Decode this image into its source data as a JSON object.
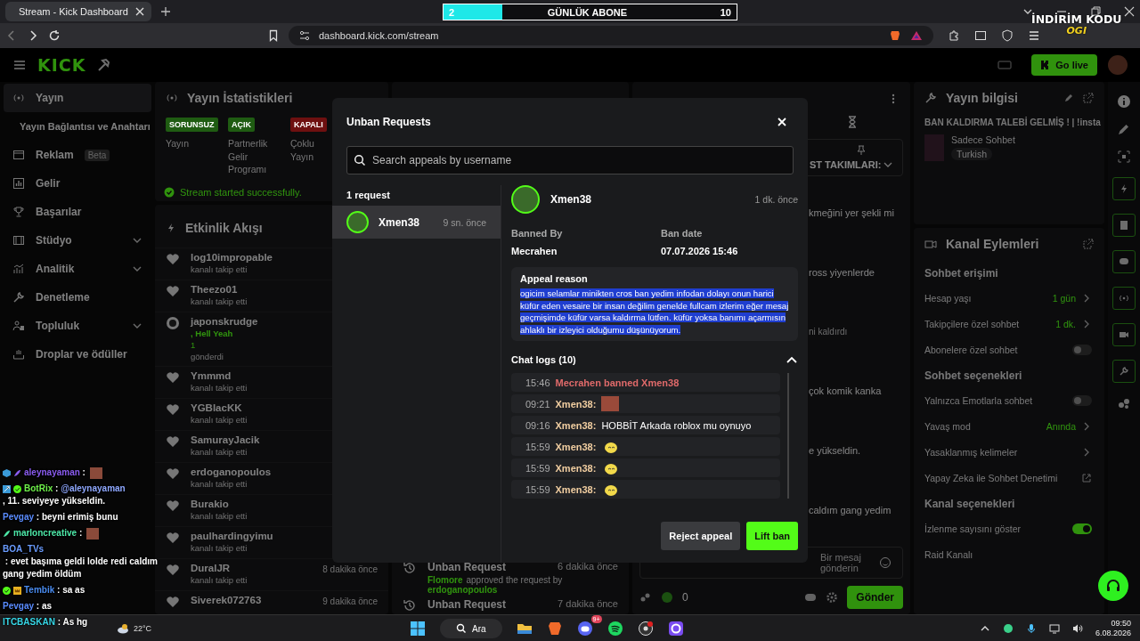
{
  "browser": {
    "tab_title": "Stream - Kick Dashboard",
    "url": "dashboard.kick.com/stream"
  },
  "sub_goal": {
    "current": "2",
    "label": "GÜNLÜK ABONE",
    "target": "10",
    "level": 0.2
  },
  "promo_overlay": {
    "title": "İNDİRİM KODU",
    "code": "OGI"
  },
  "header": {
    "logo": "KICK",
    "go_live": "Go live"
  },
  "sidebar": [
    {
      "label": "Yayın",
      "kind": "main",
      "selected": true,
      "expandable": false
    },
    {
      "label": "Yayın Bağlantısı ve Anahtarı",
      "kind": "sub",
      "selected": false,
      "expandable": false
    },
    {
      "label": "Reklam",
      "kind": "main",
      "badge": "Beta",
      "selected": false,
      "expandable": false
    },
    {
      "label": "Gelir",
      "kind": "main",
      "selected": false,
      "expandable": false
    },
    {
      "label": "Başarılar",
      "kind": "main",
      "selected": false,
      "expandable": false
    },
    {
      "label": "Stüdyo",
      "kind": "main",
      "selected": false,
      "expandable": true
    },
    {
      "label": "Analitik",
      "kind": "main",
      "selected": false,
      "expandable": true
    },
    {
      "label": "Denetleme",
      "kind": "main",
      "selected": false,
      "expandable": false
    },
    {
      "label": "Topluluk",
      "kind": "main",
      "selected": false,
      "expandable": true
    },
    {
      "label": "Droplar ve ödüller",
      "kind": "main",
      "selected": false,
      "expandable": false
    }
  ],
  "stats": {
    "title": "Yayın İstatistikleri",
    "items": [
      {
        "badge": "SORUNSUZ",
        "label": "Yayın",
        "color": "#1f5c12"
      },
      {
        "badge": "AÇIK",
        "label": "Partnerlik Gelir Programı",
        "color": "#1f5c12"
      },
      {
        "badge": "KAPALI",
        "label": "Çoklu Yayın",
        "color": "#6e1010"
      }
    ],
    "notice": "Stream started successfully."
  },
  "activity": {
    "title": "Etkinlik Akışı",
    "items": [
      {
        "kind": "follow",
        "name": "log10impropable",
        "action": "kanalı takip etti"
      },
      {
        "kind": "follow",
        "name": "Theezo01",
        "action": "kanalı takip etti"
      },
      {
        "kind": "gift",
        "name": "japonskrudge",
        "gift": ", Hell Yeah",
        "amount": "1",
        "action": "gönderdi"
      },
      {
        "kind": "follow",
        "name": "Ymmmd",
        "action": "kanalı takip etti"
      },
      {
        "kind": "follow",
        "name": "YGBlacKK",
        "action": "kanalı takip etti"
      },
      {
        "kind": "follow",
        "name": "SamurayJacik",
        "action": "kanalı takip etti"
      },
      {
        "kind": "follow",
        "name": "erdoganopoulos",
        "action": "kanalı takip etti"
      },
      {
        "kind": "follow",
        "name": "Burakio",
        "action": "kanalı takip etti"
      },
      {
        "kind": "follow",
        "name": "paulhardingyimu",
        "action": "kanalı takip etti"
      },
      {
        "kind": "follow",
        "name": "DuralJR",
        "action": "kanalı takip etti",
        "time": "8 dakika önce"
      },
      {
        "kind": "follow",
        "name": "Siverek072763",
        "time": "9 dakika önce"
      }
    ]
  },
  "mod_log": [
    {
      "title": "Unban Request",
      "time": "6 dakika önce",
      "actor": "Flomore",
      "verb": "approved the request by",
      "target": "erdoganopoulos"
    },
    {
      "title": "Unban Request",
      "time": "7 dakika önce"
    }
  ],
  "chat": {
    "pinned": "ST TAKIMLARI:",
    "lines": [
      {
        "kind": "message",
        "text": "kmeğini yer şekli mi"
      },
      {
        "kind": "message",
        "text": "ross yiyenlerde"
      },
      {
        "kind": "system",
        "text": "ni kaldırdı"
      },
      {
        "kind": "message",
        "text": "çok komik kanka"
      },
      {
        "kind": "message",
        "text": "e yükseldin."
      },
      {
        "kind": "message",
        "text": "caldım gang yedim"
      }
    ],
    "input_placeholder": "Bir mesaj gönderin",
    "kicks": "0",
    "send": "Gönder"
  },
  "stream_info": {
    "title": "Yayın bilgisi",
    "stream_title": "BAN KALDIRMA TALEBİ GELMİŞ ! | !insta",
    "category": "Sadece Sohbet",
    "tag": "Turkish"
  },
  "channel_actions": {
    "title": "Kanal Eylemleri",
    "sections": [
      {
        "heading": "Sohbet erişimi",
        "rows": [
          {
            "kind": "link",
            "label": "Hesap yaşı",
            "value": "1 gün"
          },
          {
            "kind": "link",
            "label": "Takipçilere özel sohbet",
            "value": "1 dk."
          },
          {
            "kind": "toggle",
            "label": "Abonelere özel sohbet",
            "on": false
          }
        ]
      },
      {
        "heading": "Sohbet seçenekleri",
        "rows": [
          {
            "kind": "toggle",
            "label": "Yalnızca Emotlarla sohbet",
            "on": false
          },
          {
            "kind": "link",
            "label": "Yavaş mod",
            "value": "Anında"
          },
          {
            "kind": "link",
            "label": "Yasaklanmış kelimeler"
          },
          {
            "kind": "external",
            "label": "Yapay Zeka ile Sohbet Denetimi"
          }
        ]
      },
      {
        "heading": "Kanal seçenekleri",
        "rows": [
          {
            "kind": "toggle",
            "label": "İzlenme sayısını göster",
            "on": true
          },
          {
            "kind": "plain",
            "label": "Raid Kanalı"
          }
        ]
      }
    ]
  },
  "modal": {
    "title": "Unban Requests",
    "search_placeholder": "Search appeals by username",
    "count": "1 request",
    "requests": [
      {
        "name": "Xmen38",
        "time": "9 sn. önce",
        "selected": true
      }
    ],
    "detail": {
      "name": "Xmen38",
      "time": "1 dk. önce",
      "banned_by_label": "Banned By",
      "banned_by": "Mecrahen",
      "ban_date_label": "Ban date",
      "ban_date": "07.07.2026 15:46",
      "reason_label": "Appeal reason",
      "reason": "ogicim selamlar minikten cros ban yedim infodan dolayı onun harici küfür eden vesaire bir insan değilim genelde fullcam izlerim eğer mesaj geçmişimde küfür varsa kaldırma lütfen. küfür yoksa banımı açarmısın ahlaklı bir izleyici olduğumu düşünüyorum.",
      "reason_selected": true,
      "logs_label": "Chat logs (10)",
      "logs_expanded": true,
      "logs": [
        {
          "kind": "ban",
          "time": "15:46",
          "text": "Mecrahen banned Xmen38"
        },
        {
          "kind": "image_emote",
          "time": "09:21",
          "user": "Xmen38:"
        },
        {
          "kind": "text",
          "time": "09:16",
          "user": "Xmen38:",
          "text": "HOBBİT Arkada roblox mu oynuyo"
        },
        {
          "kind": "emote",
          "time": "15:59",
          "user": "Xmen38:"
        },
        {
          "kind": "emote",
          "time": "15:59",
          "user": "Xmen38:"
        },
        {
          "kind": "emote",
          "time": "15:59",
          "user": "Xmen38:"
        }
      ]
    },
    "reject": "Reject appeal",
    "lift": "Lift ban"
  },
  "stream_chat": [
    {
      "user": "aleynayaman",
      "color": "#8a5cf0",
      "text": " : ",
      "emote": true
    },
    {
      "user": "BotRix",
      "color": "#6ef04a",
      "text": " : ",
      "mention": "@aleynayaman",
      "rest": ", 11. seviyeye yükseldin.",
      "emote": false
    },
    {
      "user": "Pevgay",
      "color": "#5a8cff",
      "text": " : beyni erimiş bunu",
      "emote": false
    },
    {
      "user": "marloncreative",
      "color": "#4de8a8",
      "text": " : ",
      "emote": true
    },
    {
      "user": "BOA_TVs",
      "color": "#6a9cff",
      "text": " : evet başıma geldi lolde redi caldım gang yedim öldüm",
      "emote": false
    },
    {
      "user": "Tembik",
      "color": "#4a8cf0",
      "text": " : sa as",
      "emote": false
    },
    {
      "user": "Pevgay",
      "color": "#5a8cff",
      "text": " : as",
      "emote": false
    },
    {
      "user": "ITCBASKAN",
      "color": "#38d8e8",
      "text": " : As hg",
      "emote": false
    }
  ],
  "taskbar": {
    "weather": "22°C",
    "search": "Ara",
    "discord_badge": "9+",
    "time": "09:50",
    "date": "6.08.2026"
  }
}
